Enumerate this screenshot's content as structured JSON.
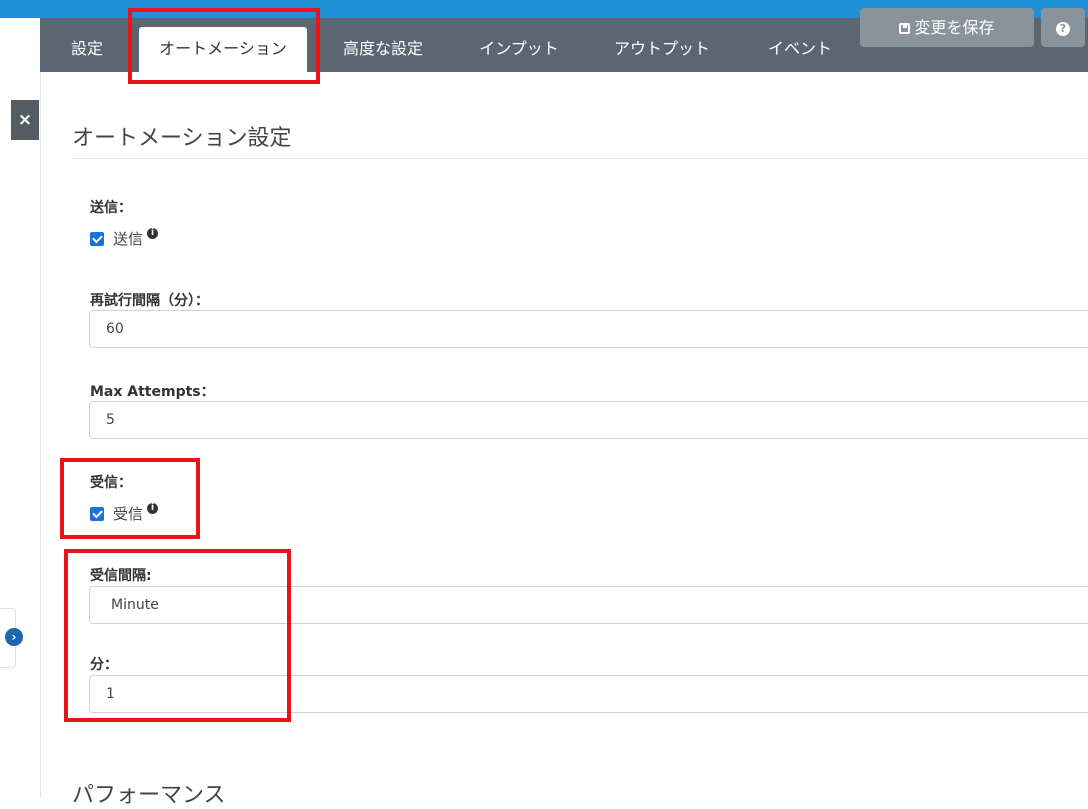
{
  "tabs": [
    {
      "label": "設定"
    },
    {
      "label": "オートメーション"
    },
    {
      "label": "高度な設定"
    },
    {
      "label": "インプット"
    },
    {
      "label": "アウトプット"
    },
    {
      "label": "イベント"
    }
  ],
  "toolbar": {
    "save_label": "変更を保存",
    "help_label": "?"
  },
  "side": {
    "close_label": "×",
    "expand_label": "›"
  },
  "section": {
    "title": "オートメーション設定",
    "next_title": "パフォーマンス"
  },
  "send": {
    "label": "送信：",
    "checkbox_label": "送信",
    "checked": true
  },
  "retry": {
    "label": "再試行間隔（分）：",
    "value": "60"
  },
  "max_attempts": {
    "label": "Max Attempts：",
    "value": "5"
  },
  "receive": {
    "label": "受信：",
    "checkbox_label": "受信",
    "checked": true
  },
  "receive_interval": {
    "label": "受信間隔:",
    "value": "Minute"
  },
  "minutes": {
    "label": "分：",
    "value": "1"
  },
  "colors": {
    "accent": "#1f8fd6",
    "tabbar": "#5c6670",
    "highlight": "#e8141a",
    "checkbox": "#1a73d9"
  }
}
